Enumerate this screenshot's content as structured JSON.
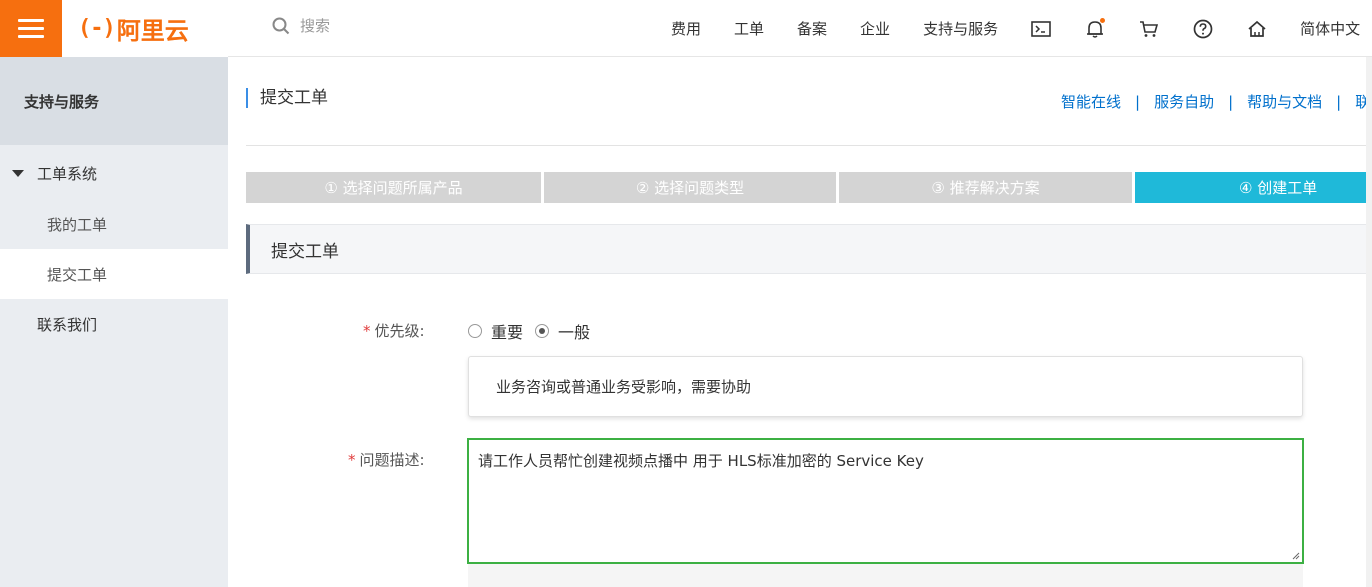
{
  "header": {
    "logo_mark": "(-)",
    "logo_text": "阿里云",
    "search_placeholder": "搜索",
    "nav": [
      "费用",
      "工单",
      "备案",
      "企业",
      "支持与服务"
    ],
    "icons": [
      "terminal-icon",
      "bell-icon",
      "cart-icon",
      "help-icon",
      "home-icon"
    ],
    "language": "简体中文"
  },
  "sidebar": {
    "title": "支持与服务",
    "group_label": "工单系统",
    "items": [
      {
        "label": "我的工单",
        "active": false
      },
      {
        "label": "提交工单",
        "active": true
      }
    ],
    "contact": "联系我们"
  },
  "main": {
    "page_title": "提交工单",
    "quick_links": [
      "智能在线",
      "服务自助",
      "帮助与文档",
      "联系我们"
    ],
    "steps": [
      {
        "label": "① 选择问题所属产品",
        "active": false
      },
      {
        "label": "② 选择问题类型",
        "active": false
      },
      {
        "label": "③ 推荐解决方案",
        "active": false
      },
      {
        "label": "④ 创建工单",
        "active": true
      }
    ],
    "section_title": "提交工单",
    "form": {
      "priority_label": "优先级:",
      "priority_options": [
        {
          "label": "重要",
          "checked": false
        },
        {
          "label": "一般",
          "checked": true
        }
      ],
      "priority_hint": "业务咨询或普通业务受影响，需要协助",
      "desc_label": "问题描述:",
      "desc_value": "请工作人员帮忙创建视频点播中 用于 HLS标准加密的 Service Key",
      "required_mark": "*"
    }
  },
  "colors": {
    "brand": "#f66f0f",
    "link": "#0070cc",
    "step_active": "#1fb9d9",
    "step_inactive": "#d4d4d4",
    "focus_border": "#3cb043"
  }
}
